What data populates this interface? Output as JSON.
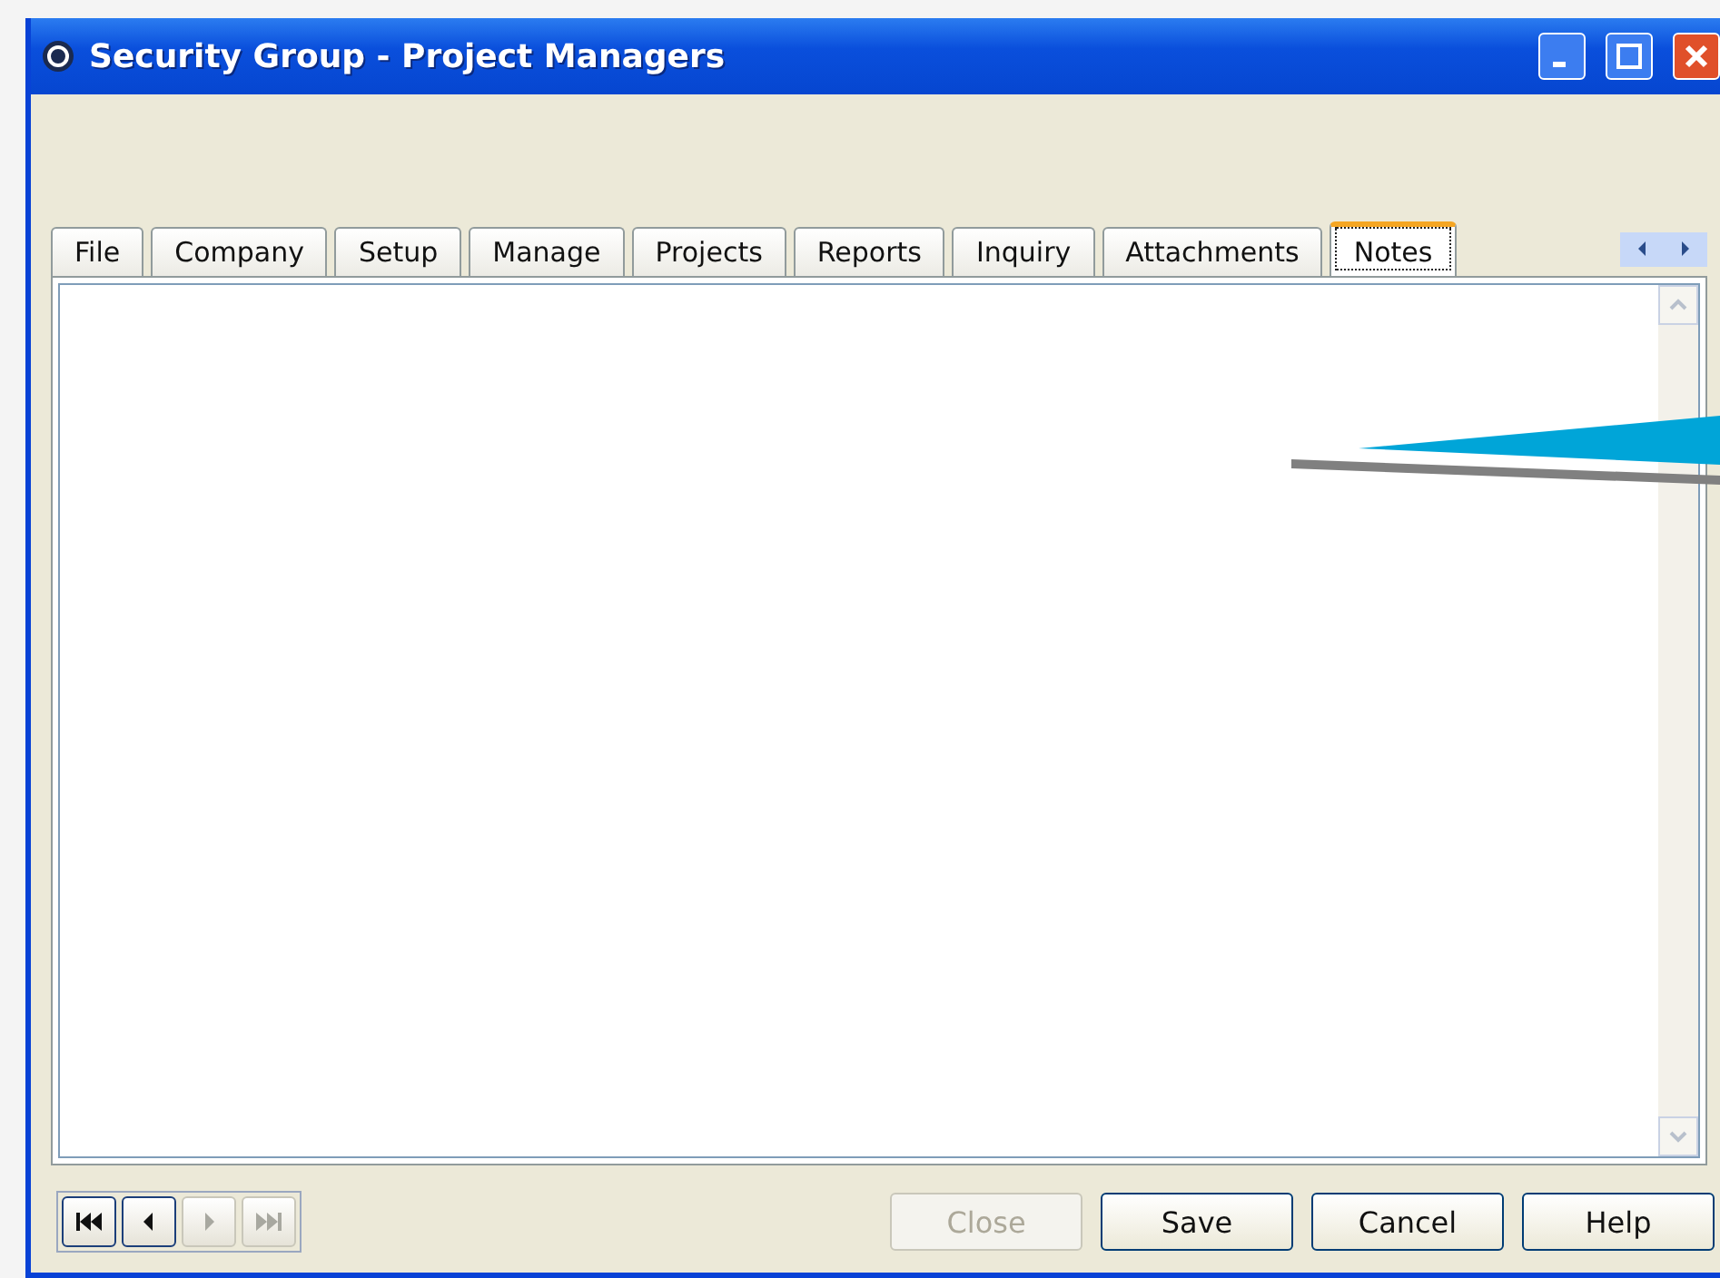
{
  "window": {
    "title": "Security Group - Project Managers"
  },
  "tabs": [
    {
      "label": "File",
      "selected": false
    },
    {
      "label": "Company",
      "selected": false
    },
    {
      "label": "Setup",
      "selected": false
    },
    {
      "label": "Manage",
      "selected": false
    },
    {
      "label": "Projects",
      "selected": false
    },
    {
      "label": "Reports",
      "selected": false
    },
    {
      "label": "Inquiry",
      "selected": false
    },
    {
      "label": "Attachments",
      "selected": false
    },
    {
      "label": "Notes",
      "selected": true
    }
  ],
  "nav_buttons": [
    {
      "kind": "first",
      "disabled": false
    },
    {
      "kind": "previous",
      "disabled": false
    },
    {
      "kind": "next",
      "disabled": true
    },
    {
      "kind": "last",
      "disabled": true
    }
  ],
  "buttons": [
    {
      "label": "Close",
      "disabled": true
    },
    {
      "label": "Save",
      "disabled": false
    },
    {
      "label": "Cancel",
      "disabled": false
    },
    {
      "label": "Help",
      "disabled": false
    }
  ]
}
